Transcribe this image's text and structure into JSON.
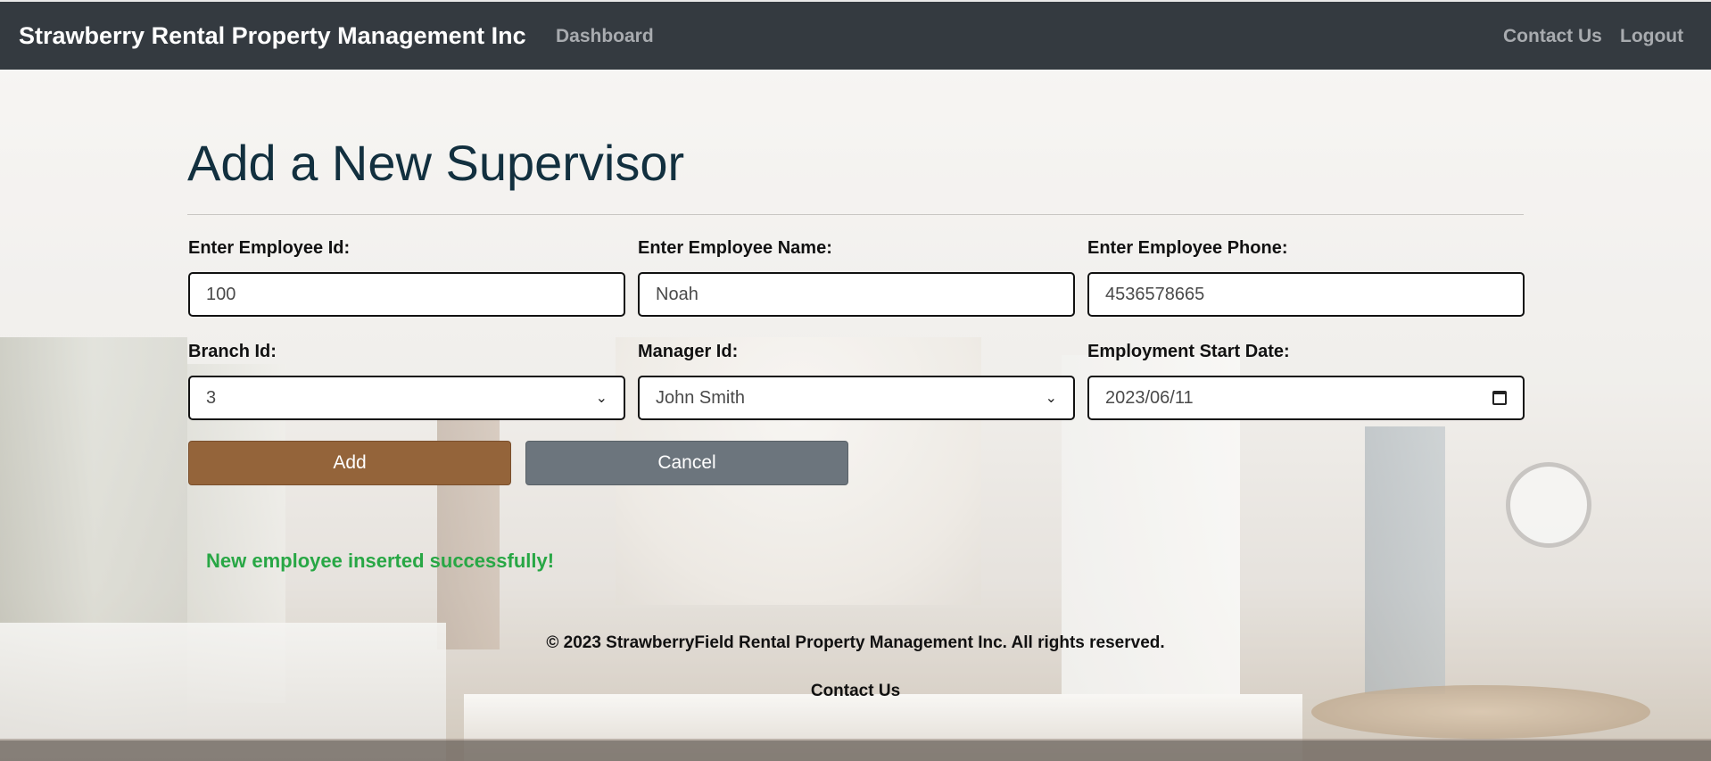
{
  "navbar": {
    "brand": "Strawberry Rental Property Management Inc",
    "dashboard": "Dashboard",
    "contact": "Contact Us",
    "logout": "Logout"
  },
  "form": {
    "title": "Add a New Supervisor",
    "employee_id_label": "Enter Employee Id:",
    "employee_id_value": "100",
    "employee_name_label": "Enter Employee Name:",
    "employee_name_value": "Noah",
    "employee_phone_label": "Enter Employee Phone:",
    "employee_phone_value": "4536578665",
    "branch_id_label": "Branch Id:",
    "branch_id_value": "3",
    "manager_id_label": "Manager Id:",
    "manager_id_value": "John Smith",
    "start_date_label": "Employment Start Date:",
    "start_date_value": "2023/06/11",
    "add_button": "Add",
    "cancel_button": "Cancel",
    "success_message": "New employee inserted successfully!"
  },
  "footer": {
    "copyright": "© 2023 StrawberryField Rental Property Management Inc. All rights reserved.",
    "contact": "Contact Us"
  },
  "colors": {
    "navbar": "#343a40",
    "add_button": "#94643a",
    "cancel_button": "#6c757d",
    "success": "#28a745",
    "title": "#12303f"
  },
  "icons": {
    "select_arrow": "chevron-down-icon",
    "date_picker": "calendar-icon"
  }
}
